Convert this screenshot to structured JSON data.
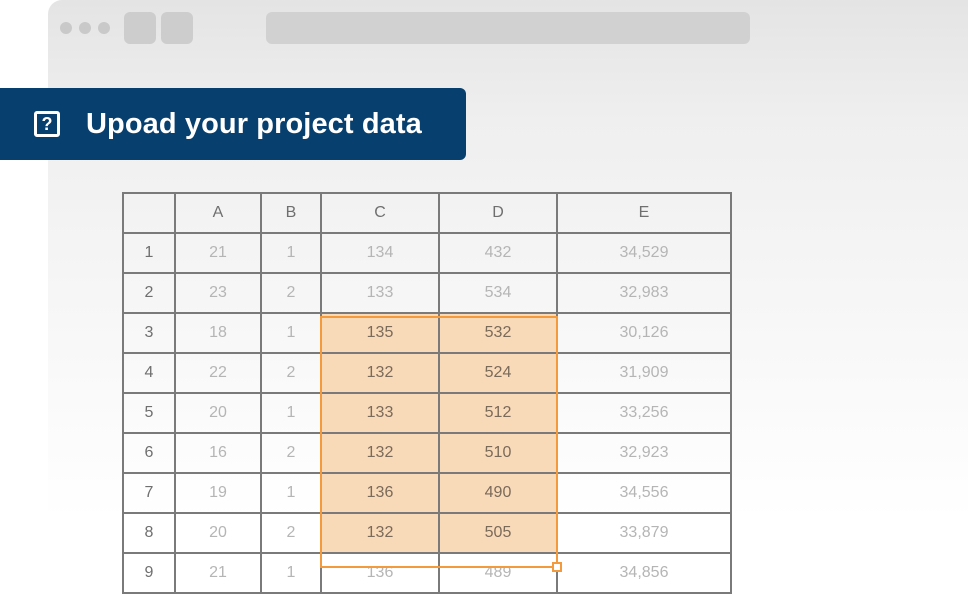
{
  "window": {
    "controls": [
      "window-dot",
      "window-dot",
      "window-dot"
    ],
    "toolbar_buttons": [
      "toolbar-button",
      "toolbar-button"
    ]
  },
  "banner": {
    "icon": "question-mark-icon",
    "icon_glyph": "?",
    "title": "Upoad your project data",
    "background": "#073f6e"
  },
  "sheet": {
    "columns": [
      "A",
      "B",
      "C",
      "D",
      "E"
    ],
    "rows": [
      {
        "num": "1",
        "cells": [
          "21",
          "1",
          "134",
          "432",
          "34,529"
        ]
      },
      {
        "num": "2",
        "cells": [
          "23",
          "2",
          "133",
          "534",
          "32,983"
        ]
      },
      {
        "num": "3",
        "cells": [
          "18",
          "1",
          "135",
          "532",
          "30,126"
        ]
      },
      {
        "num": "4",
        "cells": [
          "22",
          "2",
          "132",
          "524",
          "31,909"
        ]
      },
      {
        "num": "5",
        "cells": [
          "20",
          "1",
          "133",
          "512",
          "33,256"
        ]
      },
      {
        "num": "6",
        "cells": [
          "16",
          "2",
          "132",
          "510",
          "32,923"
        ]
      },
      {
        "num": "7",
        "cells": [
          "19",
          "1",
          "136",
          "490",
          "34,556"
        ]
      },
      {
        "num": "8",
        "cells": [
          "20",
          "2",
          "132",
          "505",
          "33,879"
        ]
      },
      {
        "num": "9",
        "cells": [
          "21",
          "1",
          "136",
          "489",
          "34,856"
        ]
      }
    ],
    "selection": {
      "columns": [
        "C",
        "D"
      ],
      "rows": [
        "3",
        "8"
      ],
      "color": "#f39a3c",
      "fill": "#f8d9b8"
    }
  }
}
